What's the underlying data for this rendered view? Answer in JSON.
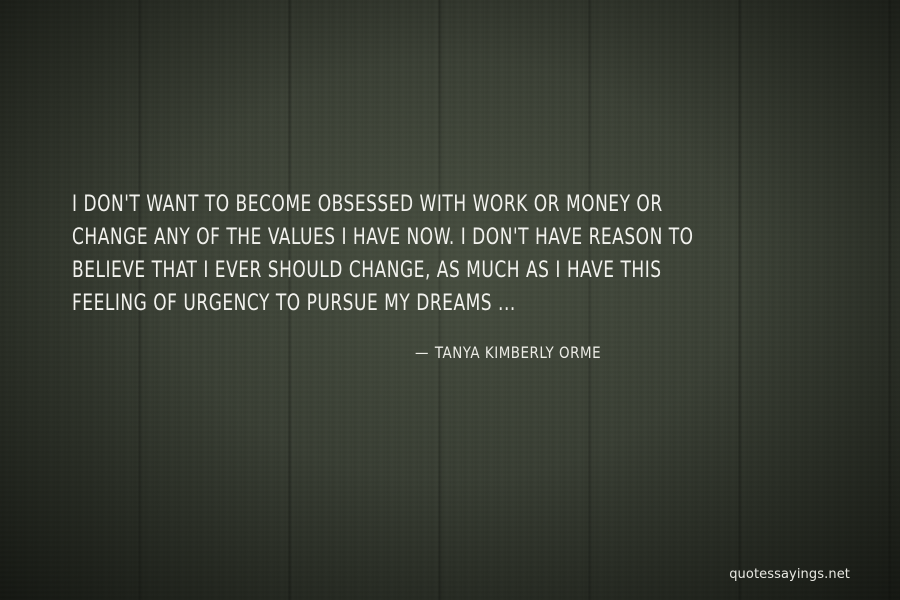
{
  "quote": {
    "lines": [
      "I DON'T WANT TO BECOME OBSESSED WITH WORK OR MONEY OR",
      "CHANGE ANY OF THE VALUES I HAVE NOW. I DON'T HAVE REASON TO",
      "BELIEVE THAT I EVER SHOULD CHANGE, AS MUCH AS I HAVE THIS",
      "FEELING OF URGENCY TO PURSUE MY DREAMS ..."
    ]
  },
  "attribution": {
    "dash": "—",
    "author": "TANYA KIMBERLY ORME"
  },
  "watermark": "quotessayings.net",
  "colors": {
    "background": "#3a3f35",
    "text": "#f2f2ee"
  }
}
